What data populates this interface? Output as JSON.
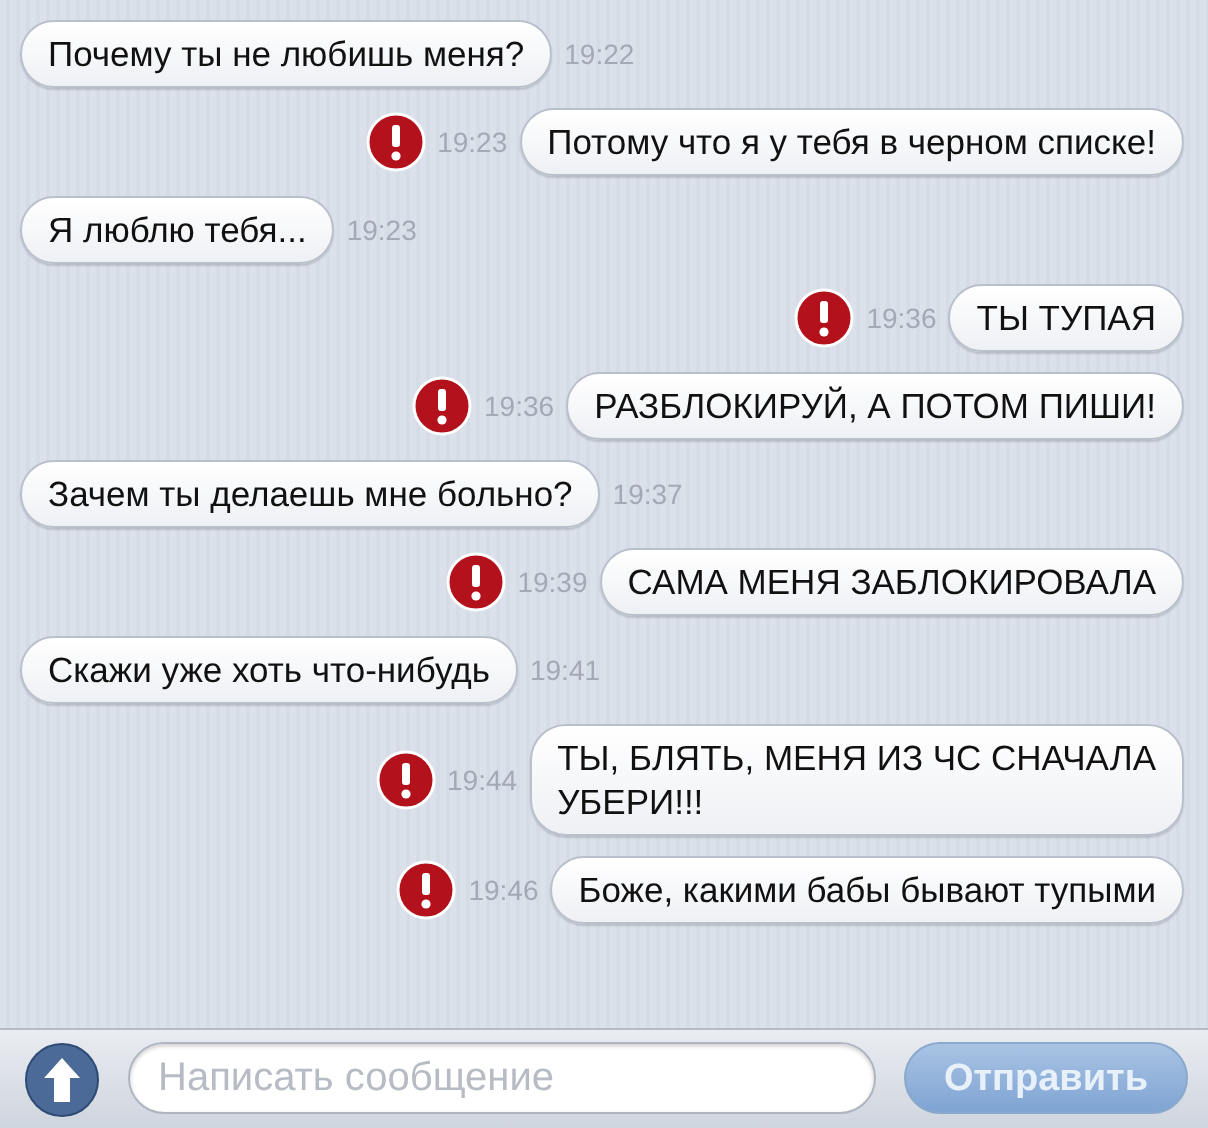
{
  "messages": [
    {
      "kind": "incoming",
      "text": "Почему ты не любишь меня?",
      "time": "19:22",
      "failed": false
    },
    {
      "kind": "outgoing",
      "text": "Потому что я у тебя в черном списке!",
      "time": "19:23",
      "failed": true
    },
    {
      "kind": "incoming",
      "text": "Я люблю тебя...",
      "time": "19:23",
      "failed": false
    },
    {
      "kind": "outgoing",
      "text": "ТЫ ТУПАЯ",
      "time": "19:36",
      "failed": true
    },
    {
      "kind": "outgoing",
      "text": "РАЗБЛОКИРУЙ, А ПОТОМ ПИШИ!",
      "time": "19:36",
      "failed": true
    },
    {
      "kind": "incoming",
      "text": "Зачем ты делаешь мне больно?",
      "time": "19:37",
      "failed": false
    },
    {
      "kind": "outgoing",
      "text": "САМА МЕНЯ ЗАБЛОКИРОВАЛА",
      "time": "19:39",
      "failed": true
    },
    {
      "kind": "incoming",
      "text": "Скажи уже хоть что-нибудь",
      "time": "19:41",
      "failed": false
    },
    {
      "kind": "outgoing",
      "text": "ТЫ, БЛЯТЬ, МЕНЯ ИЗ ЧС СНАЧАЛА\nУБЕРИ!!!",
      "time": "19:44",
      "failed": true
    },
    {
      "kind": "outgoing",
      "text": "Боже, какими бабы бывают тупыми",
      "time": "19:46",
      "failed": true
    }
  ],
  "composer": {
    "placeholder": "Написать сообщение",
    "send_label": "Отправить"
  }
}
